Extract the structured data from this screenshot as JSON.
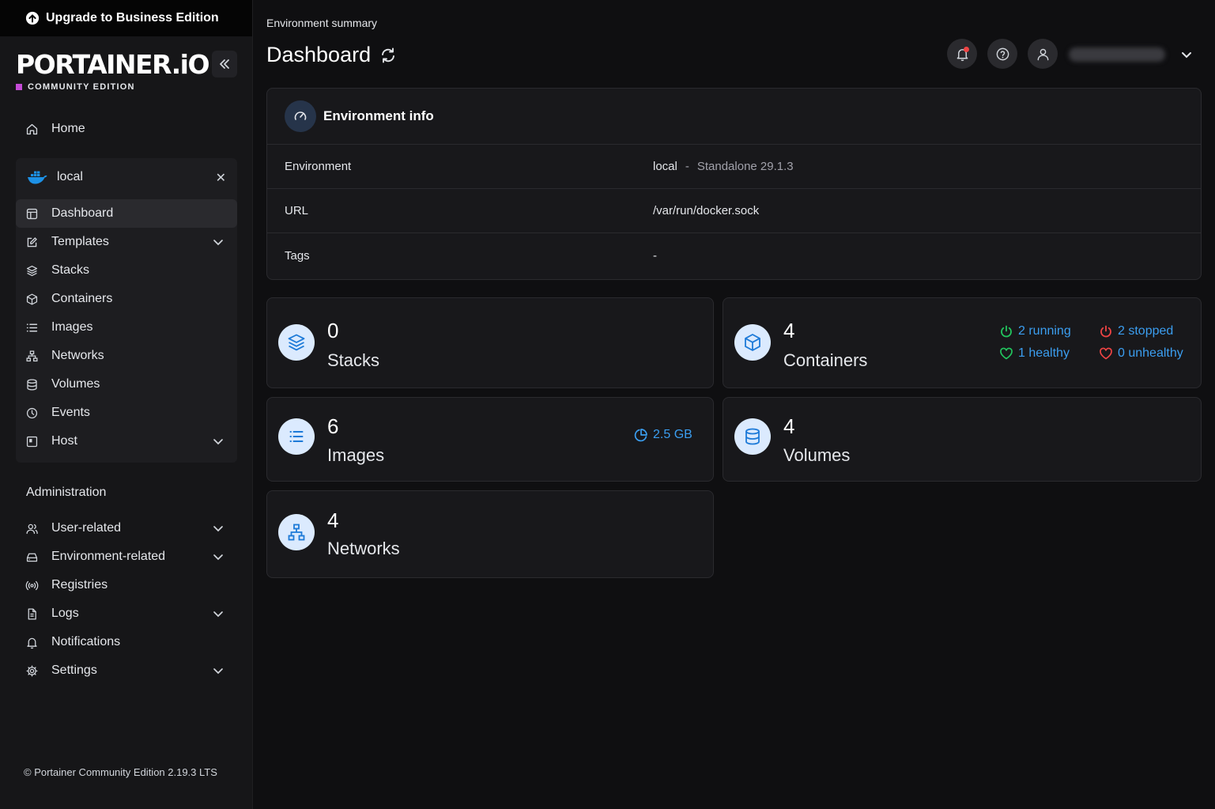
{
  "upgrade": {
    "label": "Upgrade to Business Edition"
  },
  "logo": {
    "brand": "PORTAINER.iO",
    "edition": "COMMUNITY EDITION"
  },
  "sidebar": {
    "home": "Home",
    "environment": {
      "name": "local"
    },
    "env_items": [
      {
        "label": "Dashboard",
        "icon": "dashboard-icon"
      },
      {
        "label": "Templates",
        "icon": "edit-icon"
      },
      {
        "label": "Stacks",
        "icon": "layers-icon"
      },
      {
        "label": "Containers",
        "icon": "box-icon"
      },
      {
        "label": "Images",
        "icon": "list-icon"
      },
      {
        "label": "Networks",
        "icon": "network-icon"
      },
      {
        "label": "Volumes",
        "icon": "database-icon"
      },
      {
        "label": "Events",
        "icon": "clock-icon"
      },
      {
        "label": "Host",
        "icon": "host-icon"
      }
    ],
    "admin_title": "Administration",
    "admin_items": [
      {
        "label": "User-related",
        "icon": "users-icon"
      },
      {
        "label": "Environment-related",
        "icon": "drive-icon"
      },
      {
        "label": "Registries",
        "icon": "radio-icon"
      },
      {
        "label": "Logs",
        "icon": "file-icon"
      },
      {
        "label": "Notifications",
        "icon": "bell-icon"
      },
      {
        "label": "Settings",
        "icon": "gear-icon"
      }
    ],
    "footer": "© Portainer Community Edition 2.19.3 LTS"
  },
  "header": {
    "breadcrumb": "Environment summary",
    "title": "Dashboard"
  },
  "env_info": {
    "title": "Environment info",
    "rows": {
      "environment": {
        "label": "Environment",
        "name": "local",
        "separator": "-",
        "detail": "Standalone 29.1.3"
      },
      "url": {
        "label": "URL",
        "value": "/var/run/docker.sock"
      },
      "tags": {
        "label": "Tags",
        "value": "-"
      }
    }
  },
  "cards": {
    "stacks": {
      "count": "0",
      "label": "Stacks"
    },
    "containers": {
      "count": "4",
      "label": "Containers",
      "running": "2 running",
      "stopped": "2 stopped",
      "healthy": "1 healthy",
      "unhealthy": "0 unhealthy"
    },
    "images": {
      "count": "6",
      "label": "Images",
      "size": "2.5 GB"
    },
    "volumes": {
      "count": "4",
      "label": "Volumes"
    },
    "networks": {
      "count": "4",
      "label": "Networks"
    }
  },
  "colors": {
    "accent": "#3b9ef0",
    "running": "#22c55e",
    "stopped": "#ef4444",
    "icon_bg": "#dbeafe",
    "brand_square": "#c44bd6"
  }
}
